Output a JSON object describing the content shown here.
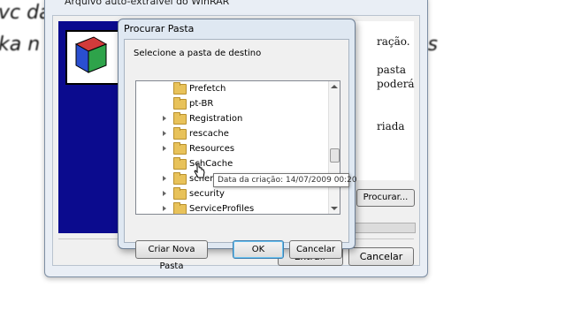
{
  "background": {
    "line1_left": "vc da",
    "line1_right": "",
    "line2_left": "ka n",
    "line2_right": "es"
  },
  "sfx": {
    "title": "Arquivo auto-extraível do WinRAR",
    "text_1": "ração.",
    "text_2": "pasta",
    "text_3": "poderá",
    "text_4": "riada",
    "procurar_label": "Procurar...",
    "extrair_label": "Extrair",
    "cancelar_label": "Cancelar"
  },
  "dialog": {
    "title": "Procurar Pasta",
    "instruction": "Selecione a pasta de destino",
    "folders": [
      {
        "name": "Prefetch",
        "expandable": false
      },
      {
        "name": "pt-BR",
        "expandable": false
      },
      {
        "name": "Registration",
        "expandable": true
      },
      {
        "name": "rescache",
        "expandable": true
      },
      {
        "name": "Resources",
        "expandable": true
      },
      {
        "name": "SchCache",
        "expandable": false
      },
      {
        "name": "schema",
        "expandable": true
      },
      {
        "name": "security",
        "expandable": true
      },
      {
        "name": "ServiceProfiles",
        "expandable": true
      }
    ],
    "tooltip": "Data da criação: 14/07/2009 00:20",
    "new_folder_label": "Criar Nova Pasta",
    "ok_label": "OK",
    "cancel_label": "Cancelar"
  }
}
